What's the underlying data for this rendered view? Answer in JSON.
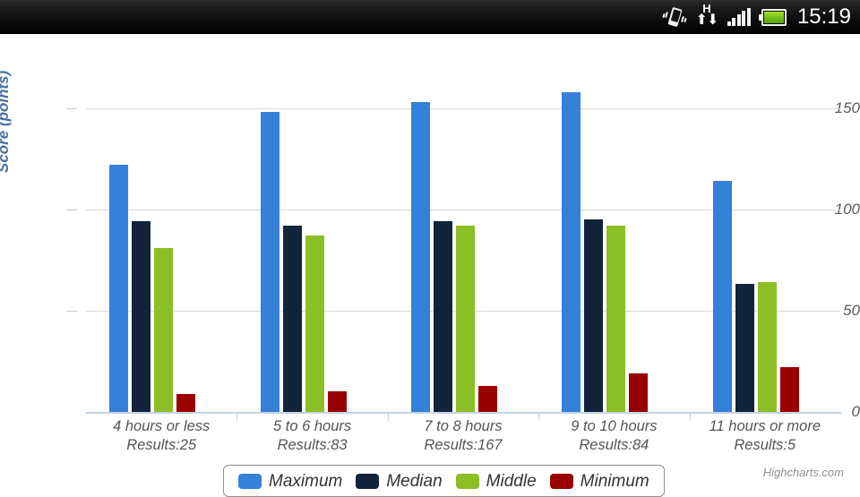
{
  "status_bar": {
    "time": "15:19",
    "network_type": "H",
    "icons": [
      "vibrate-icon",
      "hspa-data-icon",
      "signal-icon",
      "battery-icon"
    ]
  },
  "chart_data": {
    "type": "bar",
    "title": "",
    "subtitle": "",
    "xlabel": "",
    "ylabel": "Score (points)",
    "ylim": [
      0,
      160
    ],
    "yticks": [
      0,
      50,
      100,
      150
    ],
    "ytick_labels": [
      "0",
      "50",
      "100",
      "150"
    ],
    "grid": true,
    "legend_position": "bottom",
    "categories": [
      "4 hours or less",
      "5 to 6 hours",
      "7 to 8 hours",
      "9 to 10 hours",
      "11 hours or more"
    ],
    "category_sublabels": [
      "Results:25",
      "Results:83",
      "Results:167",
      "Results:84",
      "Results:5"
    ],
    "results_counts": [
      25,
      83,
      167,
      84,
      5
    ],
    "series": [
      {
        "name": "Maximum",
        "color": "#3580d8",
        "values": [
          122,
          148,
          153,
          158,
          114
        ]
      },
      {
        "name": "Median",
        "color": "#12233c",
        "values": [
          94,
          92,
          94,
          95,
          63
        ]
      },
      {
        "name": "Middle",
        "color": "#8cbf26",
        "values": [
          81,
          87,
          92,
          92,
          64
        ]
      },
      {
        "name": "Minimum",
        "color": "#990000",
        "values": [
          9,
          10,
          13,
          19,
          22
        ]
      }
    ]
  },
  "credits": {
    "text": "Highcharts.com"
  },
  "colors": {
    "maximum": "#3580d8",
    "median": "#12233c",
    "middle": "#8cbf26",
    "minimum": "#990000",
    "axis_title": "#4572A7",
    "axis_line": "#c4d3e3",
    "gridline": "#d8d8d8"
  }
}
